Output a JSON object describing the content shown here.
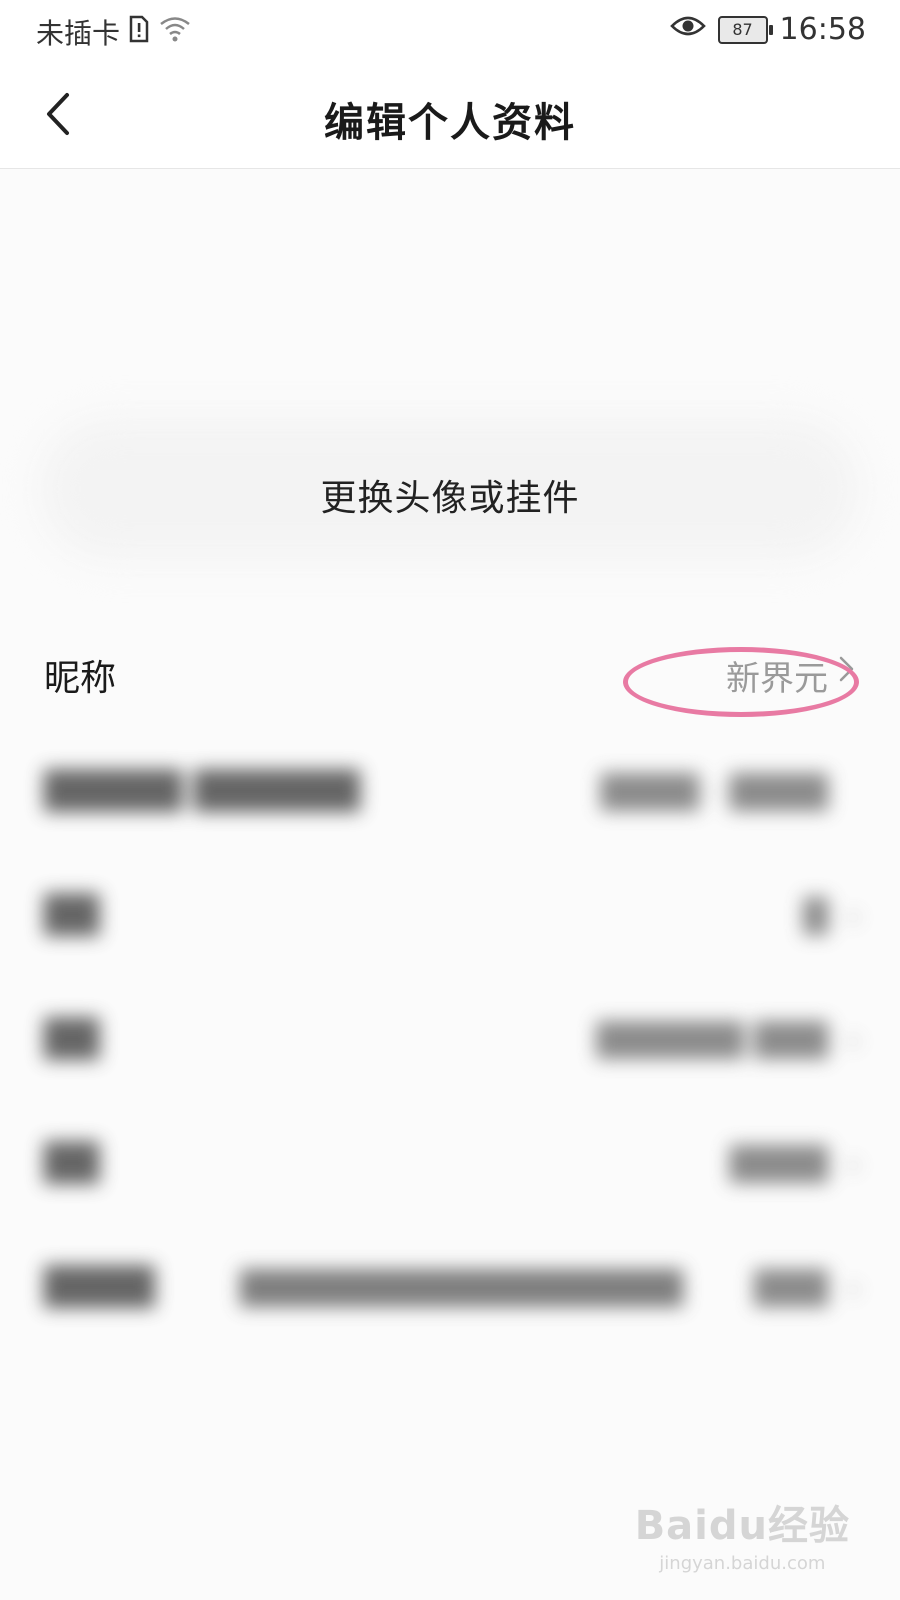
{
  "status_bar": {
    "carrier": "未插卡",
    "battery": "87",
    "time": "16:58"
  },
  "nav": {
    "title": "编辑个人资料"
  },
  "avatar": {
    "change_label": "更换头像或挂件"
  },
  "profile_rows": {
    "nickname": {
      "label": "昵称",
      "value": "新界元"
    }
  },
  "highlight_color": "#e87aa3",
  "watermark": {
    "logo": "Baidu经验",
    "url": "jingyan.baidu.com"
  }
}
